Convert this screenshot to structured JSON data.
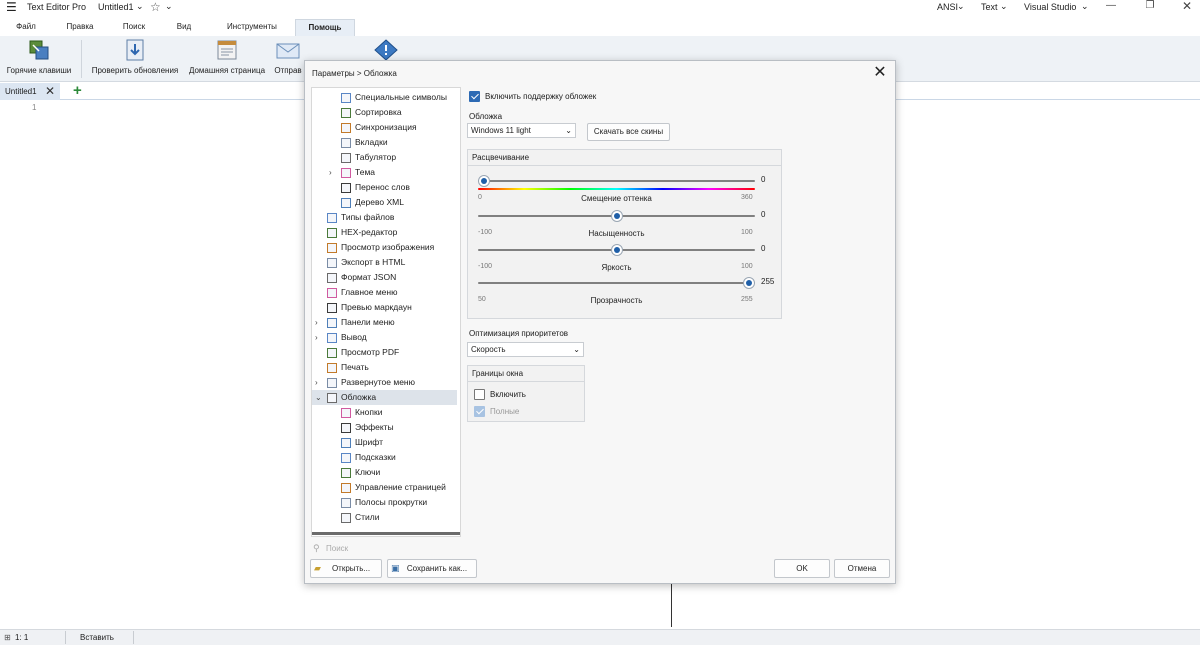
{
  "title_bar": {
    "app_name": "Text Editor Pro",
    "doc_name": "Untitled1",
    "encoding": "ANSI",
    "syntax": "Text",
    "theme": "Visual Studio"
  },
  "menu": {
    "tabs": [
      "Файл",
      "Правка",
      "Поиск",
      "Вид",
      "Инструменты",
      "Помощь"
    ]
  },
  "ribbon": {
    "buttons": [
      "Горячие клавиши",
      "Проверить обновления",
      "Домашняя страница",
      "Отправ"
    ]
  },
  "doc_tabs": {
    "active": "Untitled1",
    "add": "+"
  },
  "editor": {
    "line_number": "1"
  },
  "status_bar": {
    "position": "1: 1",
    "mode": "Вставить"
  },
  "dialog": {
    "breadcrumb": "Параметры  >  Обложка",
    "close": "✕",
    "tree": [
      {
        "label": "Специальные символы",
        "level": 1
      },
      {
        "label": "Сортировка",
        "level": 1
      },
      {
        "label": "Синхронизация",
        "level": 1
      },
      {
        "label": "Вкладки",
        "level": 1
      },
      {
        "label": "Табулятор",
        "level": 1
      },
      {
        "label": "Тема",
        "level": 1,
        "expandable": true
      },
      {
        "label": "Перенос слов",
        "level": 1
      },
      {
        "label": "Дерево XML",
        "level": 1
      },
      {
        "label": "Типы файлов",
        "level": 0
      },
      {
        "label": "HEX-редактор",
        "level": 0
      },
      {
        "label": "Просмотр изображения",
        "level": 0
      },
      {
        "label": "Экспорт в HTML",
        "level": 0
      },
      {
        "label": "Формат JSON",
        "level": 0
      },
      {
        "label": "Главное меню",
        "level": 0
      },
      {
        "label": "Превью маркдаун",
        "level": 0
      },
      {
        "label": "Панели меню",
        "level": 0,
        "expandable": true
      },
      {
        "label": "Вывод",
        "level": 0,
        "expandable": true
      },
      {
        "label": "Просмотр PDF",
        "level": 0
      },
      {
        "label": "Печать",
        "level": 0
      },
      {
        "label": "Развернутое меню",
        "level": 0,
        "expandable": true
      },
      {
        "label": "Обложка",
        "level": 0,
        "expanded": true,
        "selected": true
      },
      {
        "label": "Кнопки",
        "level": 1
      },
      {
        "label": "Эффекты",
        "level": 1
      },
      {
        "label": "Шрифт",
        "level": 1
      },
      {
        "label": "Подсказки",
        "level": 1
      },
      {
        "label": "Ключи",
        "level": 1
      },
      {
        "label": "Управление страницей",
        "level": 1
      },
      {
        "label": "Полосы прокрутки",
        "level": 1
      },
      {
        "label": "Стили",
        "level": 1
      }
    ],
    "search_placeholder": "Поиск",
    "open_button": "Открыть...",
    "save_as_button": "Сохранить как...",
    "ok_button": "OK",
    "cancel_button": "Отмена",
    "enable_skins_label": "Включить поддержку обложек",
    "enable_skins_checked": true,
    "skins_label": "Обложка",
    "skin_value": "Windows 11 light",
    "download_skins_button": "Скачать все скины",
    "coloring_group": "Расцвечивание",
    "sliders": [
      {
        "caption": "Смещение оттенка",
        "value": "0",
        "min": "0",
        "max": "360",
        "fraction": 0.0,
        "rainbow": true
      },
      {
        "caption": "Насыщенность",
        "value": "0",
        "min": "-100",
        "max": "100",
        "fraction": 0.5
      },
      {
        "caption": "Яркость",
        "value": "0",
        "min": "-100",
        "max": "100",
        "fraction": 0.5
      },
      {
        "caption": "Прозрачность",
        "value": "255",
        "min": "50",
        "max": "255",
        "fraction": 1.0
      }
    ],
    "priority_label": "Оптимизация приоритетов",
    "priority_value": "Скорость",
    "borders_group": "Границы окна",
    "borders_enable_label": "Включить",
    "borders_enable_checked": false,
    "borders_full_label": "Полные",
    "borders_full_checked": true
  }
}
